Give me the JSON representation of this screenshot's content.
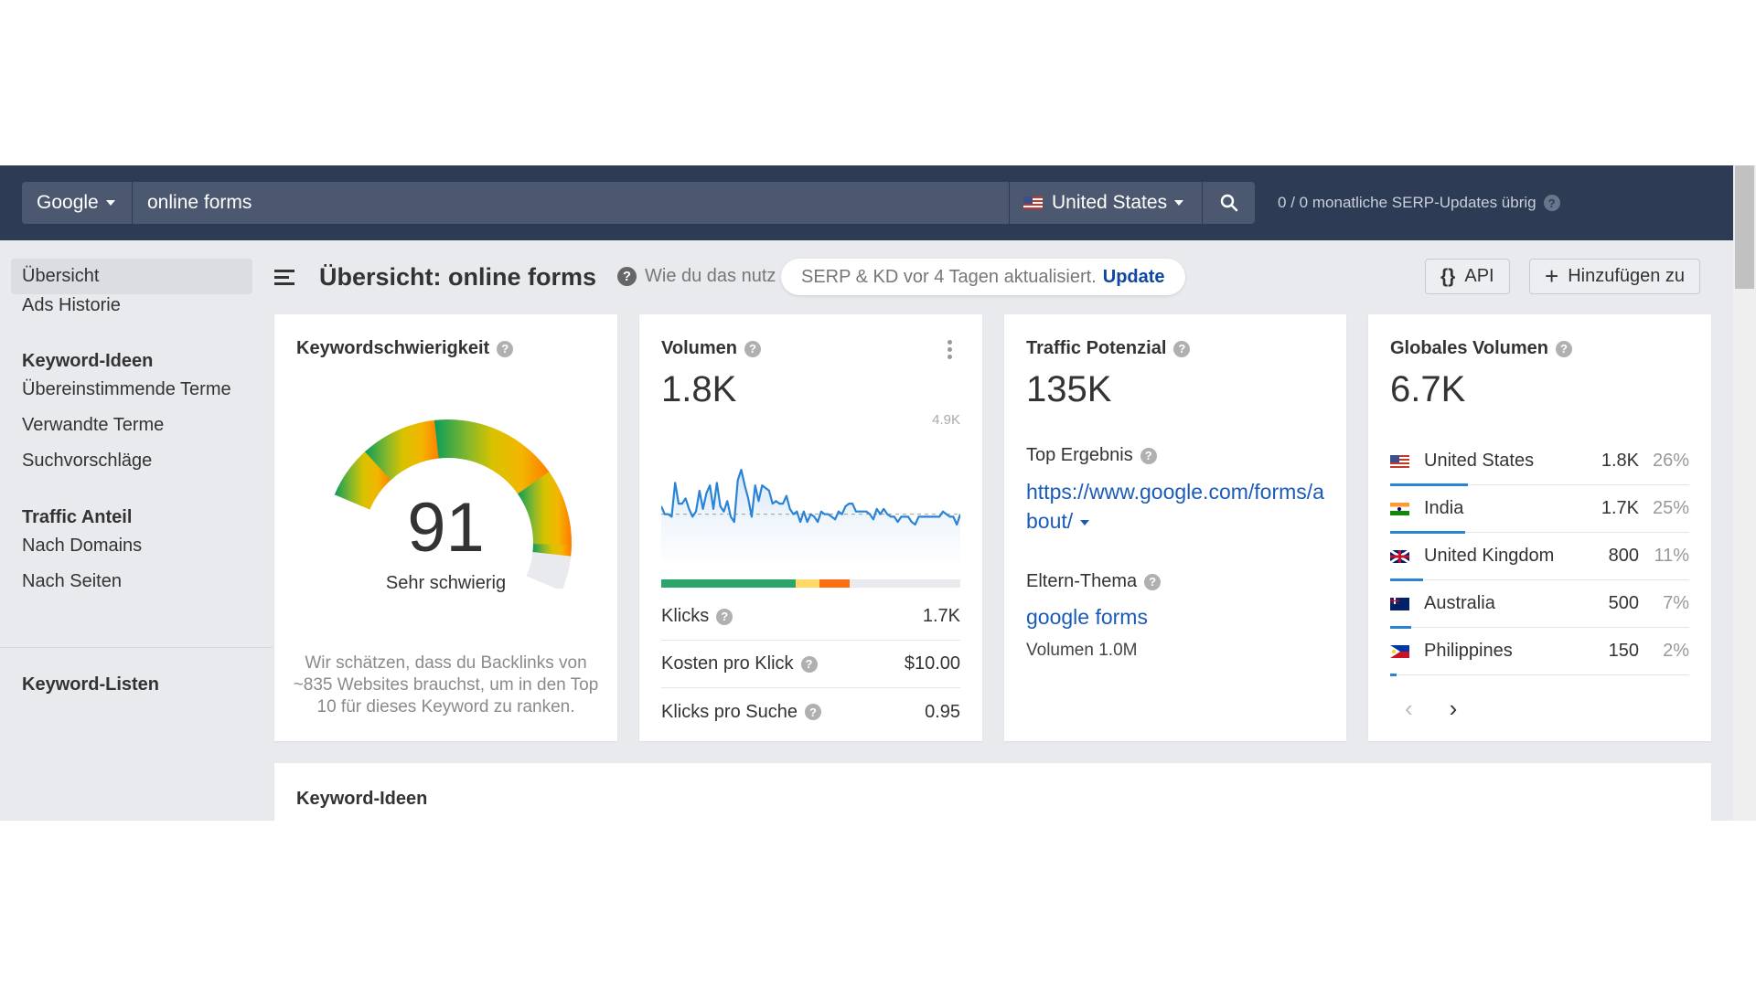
{
  "header": {
    "engine": "Google",
    "keyword": "online forms",
    "country": "United States",
    "serp_used": "0",
    "serp_total": "0",
    "serp_text": "monatliche SERP-Updates übrig",
    "serp_sep": "/"
  },
  "sidebar": {
    "items": [
      {
        "label": "Übersicht",
        "active": true
      },
      {
        "label": "Ads Historie"
      }
    ],
    "sections": [
      {
        "heading": "Keyword-Ideen",
        "items": [
          "Übereinstimmende Terme",
          "Verwandte Terme",
          "Suchvorschläge"
        ]
      },
      {
        "heading": "Traffic Anteil",
        "items": [
          "Nach Domains",
          "Nach Seiten"
        ]
      }
    ],
    "lists_heading": "Keyword-Listen"
  },
  "titlebar": {
    "title": "Übersicht: online forms",
    "howto": "Wie du das nutz",
    "update_text": "SERP & KD vor 4 Tagen aktualisiert.",
    "update_link": "Update",
    "api_label": "API",
    "add_label": "Hinzufügen zu"
  },
  "kd": {
    "title": "Keywordschwierigkeit",
    "value": 91,
    "max": 100,
    "label": "Sehr schwierig",
    "description": "Wir schätzen, dass du Backlinks von ~835 Websites brauchst, um in den Top 10 für dieses Keyword zu ranken.",
    "colors": [
      "#0a9d5a",
      "#4fae3b",
      "#b5c21a",
      "#f3b600",
      "#ff7a00",
      "#e9eaee"
    ]
  },
  "volume": {
    "title": "Volumen",
    "value": "1.8K",
    "spark_max_label": "4.9K",
    "spark_max": 4900,
    "spark_avg": 1800,
    "spark_values": [
      2100,
      1800,
      1800,
      1700,
      3000,
      2200,
      2200,
      2400,
      2000,
      1700,
      1900,
      2700,
      2000,
      2600,
      2900,
      2000,
      3000,
      2100,
      1900,
      2300,
      1700,
      1500,
      3100,
      3500,
      2900,
      2400,
      1700,
      2900,
      2300,
      2900,
      2800,
      2700,
      2200,
      2300,
      2200,
      2200,
      2500,
      2000,
      1800,
      1900,
      1500,
      1900,
      1500,
      1800,
      1700,
      1500,
      1900,
      1800,
      1800,
      1700,
      1600,
      1900,
      1800,
      2100,
      2200,
      2200,
      1900,
      1900,
      1900,
      1900,
      1800,
      1600,
      2000,
      1800,
      2000,
      1800,
      1700,
      1700,
      1500,
      1700,
      1700,
      1700,
      1500,
      1400,
      1700,
      1700,
      1700,
      1700,
      1700,
      1700,
      1700,
      1900,
      1800,
      1700,
      1700,
      1400,
      1800
    ],
    "click_split": [
      {
        "share": 0.45,
        "color": "#2aa66a"
      },
      {
        "share": 0.08,
        "color": "#ffd866"
      },
      {
        "share": 0.1,
        "color": "#ff6d12"
      }
    ],
    "metrics": [
      {
        "label": "Klicks",
        "value": "1.7K"
      },
      {
        "label": "Kosten pro Klick",
        "value": "$10.00"
      },
      {
        "label": "Klicks pro Suche",
        "value": "0.95"
      }
    ]
  },
  "traffic": {
    "title": "Traffic Potenzial",
    "value": "135K",
    "top_label": "Top Ergebnis",
    "top_url": "https://www.google.com/forms/about/",
    "parent_label": "Eltern-Thema",
    "parent_topic": "google forms",
    "parent_volume": "Volumen 1.0M"
  },
  "global": {
    "title": "Globales Volumen",
    "value": "6.7K",
    "countries": [
      {
        "flag": "us",
        "name": "United States",
        "volume": "1.8K",
        "pct": "26%",
        "share": 26
      },
      {
        "flag": "in",
        "name": "India",
        "volume": "1.7K",
        "pct": "25%",
        "share": 25
      },
      {
        "flag": "uk",
        "name": "United Kingdom",
        "volume": "800",
        "pct": "11%",
        "share": 11
      },
      {
        "flag": "au",
        "name": "Australia",
        "volume": "500",
        "pct": "7%",
        "share": 7
      },
      {
        "flag": "ph",
        "name": "Philippines",
        "volume": "150",
        "pct": "2%",
        "share": 2
      }
    ],
    "prev": "‹",
    "next": "›"
  },
  "ideas": {
    "title": "Keyword-Ideen"
  },
  "icons": {
    "help": "?",
    "search": "search-icon",
    "api": "{}",
    "plus": "+"
  }
}
